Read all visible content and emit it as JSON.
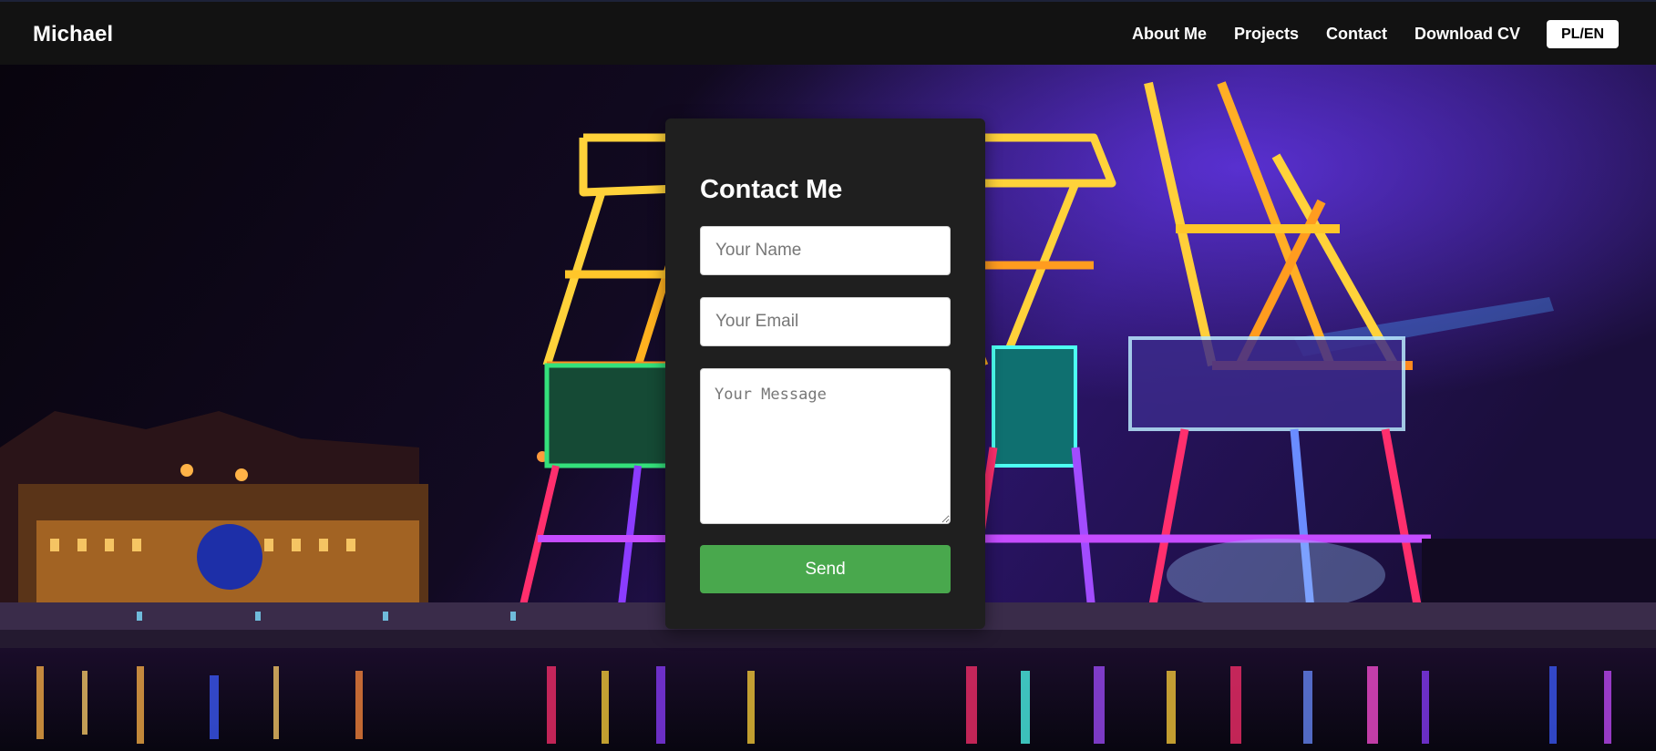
{
  "navbar": {
    "brand": "Michael",
    "links": [
      "About Me",
      "Projects",
      "Contact",
      "Download CV"
    ],
    "language_toggle": "PL/EN"
  },
  "contact": {
    "title": "Contact Me",
    "name_placeholder": "Your Name",
    "email_placeholder": "Your Email",
    "message_placeholder": "Your Message",
    "send_label": "Send"
  },
  "colors": {
    "navbar_bg": "#121212",
    "card_bg": "#1f1f1f",
    "send_button": "#49a84d"
  }
}
